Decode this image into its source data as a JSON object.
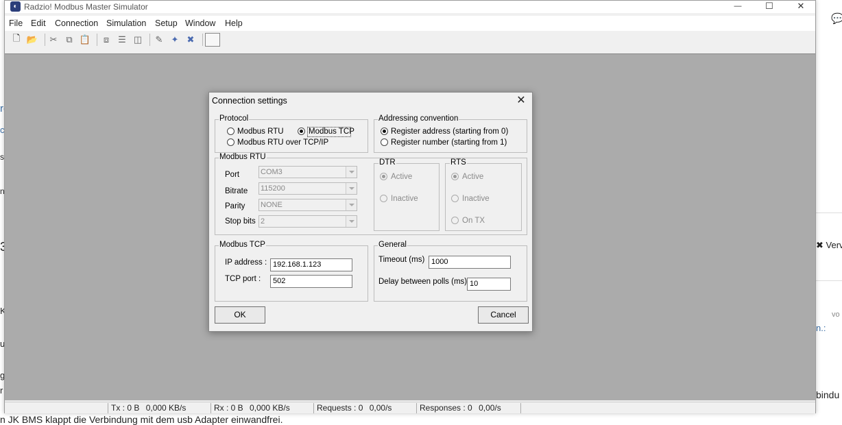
{
  "app": {
    "title": "Radzio! Modbus Master Simulator",
    "controls": {
      "minimize": "—",
      "maximize": "☐",
      "close": "✕"
    }
  },
  "menu": [
    "File",
    "Edit",
    "Connection",
    "Simulation",
    "Setup",
    "Window",
    "Help"
  ],
  "toolbar_icons": [
    "new-document-icon",
    "open-folder-icon",
    "cut-icon",
    "copy-icon",
    "paste-icon",
    "cascade-windows-icon",
    "tile-horizontal-icon",
    "tile-vertical-icon",
    "connect-icon",
    "disconnect-icon",
    "settings-icon",
    "blank-button"
  ],
  "dialog": {
    "title": "Connection settings",
    "close": "✕",
    "protocol": {
      "label": "Protocol",
      "options": [
        "Modbus RTU",
        "Modbus TCP",
        "Modbus RTU over TCP/IP"
      ],
      "selected": "Modbus TCP"
    },
    "addressing": {
      "label": "Addressing convention",
      "options": [
        "Register address (starting from 0)",
        "Register number (starting from 1)"
      ],
      "selected": "Register address (starting from 0)"
    },
    "rtu": {
      "label": "Modbus RTU",
      "port_label": "Port",
      "port_value": "COM3",
      "bitrate_label": "Bitrate",
      "bitrate_value": "115200",
      "parity_label": "Parity",
      "parity_value": "NONE",
      "stopbits_label": "Stop bits",
      "stopbits_value": "2"
    },
    "dtr": {
      "label": "DTR",
      "options": [
        "Active",
        "Inactive"
      ],
      "selected": "Active"
    },
    "rts": {
      "label": "RTS",
      "options": [
        "Active",
        "Inactive",
        "On TX"
      ],
      "selected": "Active"
    },
    "tcp": {
      "label": "Modbus TCP",
      "ip_label": "IP address :",
      "ip_value": "192.168.1.123",
      "port_label": "TCP port :",
      "port_value": "502"
    },
    "general": {
      "label": "General",
      "timeout_label": "Timeout (ms)",
      "timeout_value": "1000",
      "delay_label": "Delay between polls (ms)",
      "delay_value": "10"
    },
    "ok": "OK",
    "cancel": "Cancel"
  },
  "status": {
    "tx": "Tx : 0 B",
    "tx_rate": "0,000 KB/s",
    "rx": "Rx : 0 B",
    "rx_rate": "0,000 KB/s",
    "requests": "Requests : 0",
    "requests_rate": "0,00/s",
    "responses": "Responses : 0",
    "responses_rate": "0,00/s"
  },
  "background": {
    "bottom_text": "n JK BMS klappt die Verbindung mit dem usb Adapter einwandfrei.",
    "right_button": "Verv",
    "right_vo": "vo",
    "right_colon": "n.:",
    "right_bindu": "bindu",
    "left_fragments": [
      "ro",
      "c",
      "su",
      "nt",
      "3",
      "K",
      "u",
      "g",
      "r"
    ]
  }
}
